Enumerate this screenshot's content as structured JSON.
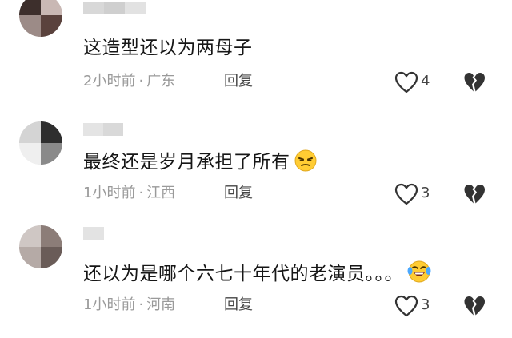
{
  "comments": [
    {
      "text": "这造型还以为两母子",
      "time": "2小时前",
      "location": "广东",
      "reply_label": "回复",
      "likes": "4",
      "emoji": null
    },
    {
      "text": "最终还是岁月承担了所有",
      "time": "1小时前",
      "location": "江西",
      "reply_label": "回复",
      "likes": "3",
      "emoji": "smirk-emoji"
    },
    {
      "text": "还以为是哪个六七十年代的老演员。。。",
      "time": "1小时前",
      "location": "河南",
      "reply_label": "回复",
      "likes": "3",
      "emoji": "crying-laughing-emoji"
    }
  ],
  "meta_separator": "·",
  "icons": {
    "like": "heart-outline-icon",
    "dislike": "broken-heart-icon"
  },
  "colors": {
    "text": "#161616",
    "meta": "#9a9a9a",
    "action": "#444444",
    "emoji_face": "#ffcc33"
  }
}
